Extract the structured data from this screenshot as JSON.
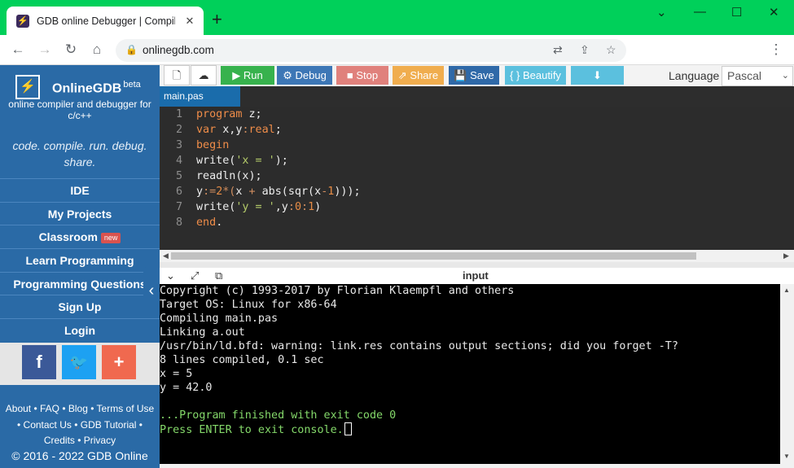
{
  "browser": {
    "tab_title": "GDB online Debugger | Compiler",
    "favicon": "⚡",
    "new_tab": "+",
    "url": "onlinegdb.com",
    "icons": [
      "back-arrow-icon",
      "forward-arrow-icon",
      "reload-icon",
      "home-icon",
      "lock-icon",
      "translate-icon",
      "share-icon",
      "star-icon",
      "menu-dots-icon"
    ]
  },
  "sidebar": {
    "brand_name": "OnlineGDB",
    "brand_beta": "beta",
    "brand_sub": "online compiler and debugger for c/c++",
    "tagline": "code. compile. run. debug. share.",
    "menu": [
      {
        "label": "IDE"
      },
      {
        "label": "My Projects"
      },
      {
        "label": "Classroom",
        "badge": "new"
      },
      {
        "label": "Learn Programming"
      },
      {
        "label": "Programming Questions"
      },
      {
        "label": "Sign Up"
      },
      {
        "label": "Login"
      }
    ],
    "social": {
      "facebook": "f",
      "twitter": "🐦",
      "more": "+"
    },
    "footer_line1": "About • FAQ • Blog • Terms of Use",
    "footer_line2": "• Contact Us • GDB Tutorial •",
    "footer_line3": "Credits • Privacy",
    "copyright": "© 2016 - 2022 GDB Online"
  },
  "toolbar": {
    "run": "Run",
    "debug": "Debug",
    "stop": "Stop",
    "share": "Share",
    "save": "Save",
    "beautify": "{ } Beautify",
    "language_label": "Language",
    "language_value": "Pascal",
    "colors": {
      "run": "#37b24d",
      "debug": "#3d77b6",
      "stop": "#e0817c",
      "share": "#f0ad4e",
      "save": "#2f69a8",
      "beautify": "#5bc0de",
      "download": "#5bc0de"
    }
  },
  "editor": {
    "file_tab": "main.pas",
    "line_numbers": [
      "1",
      "2",
      "3",
      "4",
      "5",
      "6",
      "7",
      "8"
    ],
    "lines": [
      "program z;",
      "var x,y:real;",
      "begin",
      "write('x = ');",
      "readln(x);",
      "y:=2*(x + abs(sqr(x-1)));",
      "write('y = ',y:0:1)",
      "end."
    ]
  },
  "console": {
    "title": "input",
    "lines": [
      "Copyright (c) 1993-2017 by Florian Klaempfl and others",
      "Target OS: Linux for x86-64",
      "Compiling main.pas",
      "Linking a.out",
      "/usr/bin/ld.bfd: warning: link.res contains output sections; did you forget -T?",
      "8 lines compiled, 0.1 sec",
      "x = 5",
      "y = 42.0",
      "",
      "...Program finished with exit code 0",
      "Press ENTER to exit console."
    ]
  }
}
